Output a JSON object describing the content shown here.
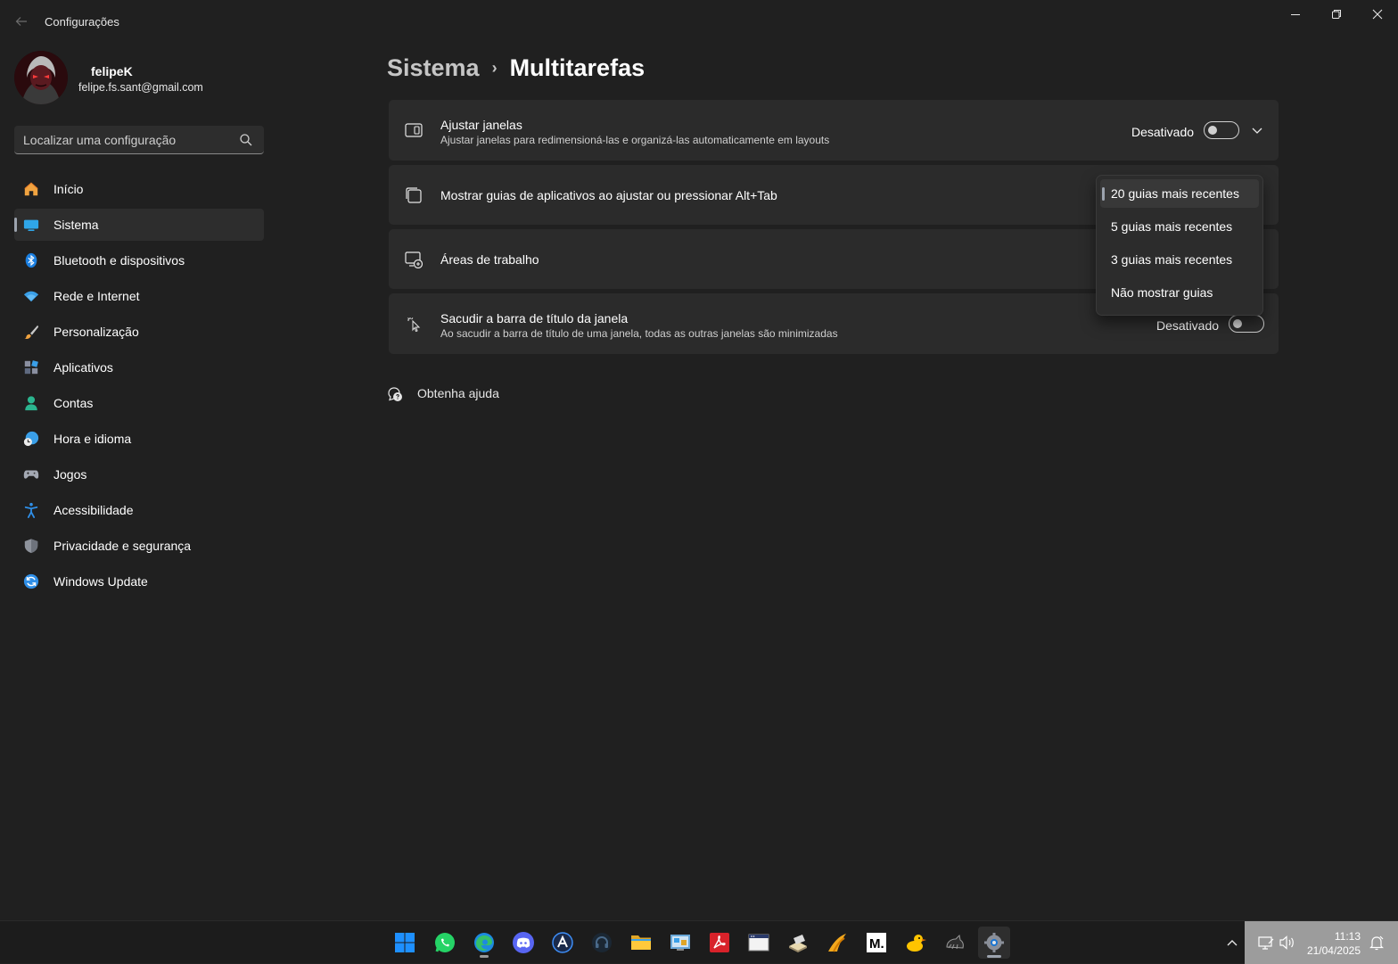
{
  "window": {
    "title": "Configurações"
  },
  "profile": {
    "name": "felipeK",
    "email": "felipe.fs.sant@gmail.com"
  },
  "search": {
    "placeholder": "Localizar uma configuração",
    "icon": "search-icon"
  },
  "sidebar": {
    "items": [
      {
        "label": "Início",
        "icon": "home-icon",
        "selected": false
      },
      {
        "label": "Sistema",
        "icon": "monitor-icon",
        "selected": true
      },
      {
        "label": "Bluetooth e dispositivos",
        "icon": "bluetooth-icon",
        "selected": false
      },
      {
        "label": "Rede e Internet",
        "icon": "wifi-icon",
        "selected": false
      },
      {
        "label": "Personalização",
        "icon": "brush-icon",
        "selected": false
      },
      {
        "label": "Aplicativos",
        "icon": "apps-icon",
        "selected": false
      },
      {
        "label": "Contas",
        "icon": "person-icon",
        "selected": false
      },
      {
        "label": "Hora e idioma",
        "icon": "clock-globe-icon",
        "selected": false
      },
      {
        "label": "Jogos",
        "icon": "gamepad-icon",
        "selected": false
      },
      {
        "label": "Acessibilidade",
        "icon": "accessibility-icon",
        "selected": false
      },
      {
        "label": "Privacidade e segurança",
        "icon": "shield-icon",
        "selected": false
      },
      {
        "label": "Windows Update",
        "icon": "update-icon",
        "selected": false
      }
    ]
  },
  "breadcrumb": {
    "parent": "Sistema",
    "separator": "›",
    "current": "Multitarefas"
  },
  "settings": {
    "snap": {
      "title": "Ajustar janelas",
      "description": "Ajustar janelas para redimensioná-las e organizá-las automaticamente em layouts",
      "state_label": "Desativado",
      "on": false
    },
    "tabs": {
      "title": "Mostrar guias de aplicativos ao ajustar ou pressionar Alt+Tab"
    },
    "desktops": {
      "title": "Áreas de trabalho"
    },
    "shake": {
      "title": "Sacudir a barra de título da janela",
      "description": "Ao sacudir a barra de título de uma janela, todas as outras janelas são minimizadas",
      "state_label": "Desativado",
      "on": false
    }
  },
  "dropdown": {
    "options": [
      {
        "label": "20 guias mais recentes",
        "selected": true
      },
      {
        "label": "5 guias mais recentes",
        "selected": false
      },
      {
        "label": "3 guias mais recentes",
        "selected": false
      },
      {
        "label": "Não mostrar guias",
        "selected": false
      }
    ]
  },
  "help": {
    "label": "Obtenha ajuda"
  },
  "taskbar": {
    "apps": [
      "start",
      "whatsapp",
      "edge",
      "discord",
      "arc",
      "headset",
      "file-explorer",
      "control-panel",
      "adobe-reader",
      "window-app",
      "book-app",
      "sandbox-app",
      "medium",
      "duck-app",
      "cat-app",
      "settings"
    ],
    "clock": {
      "time": "11:13",
      "date": "21/04/2025"
    }
  },
  "colors": {
    "background": "#202020",
    "card": "#2b2b2b",
    "accent_indicator": "#9ca3ae"
  }
}
